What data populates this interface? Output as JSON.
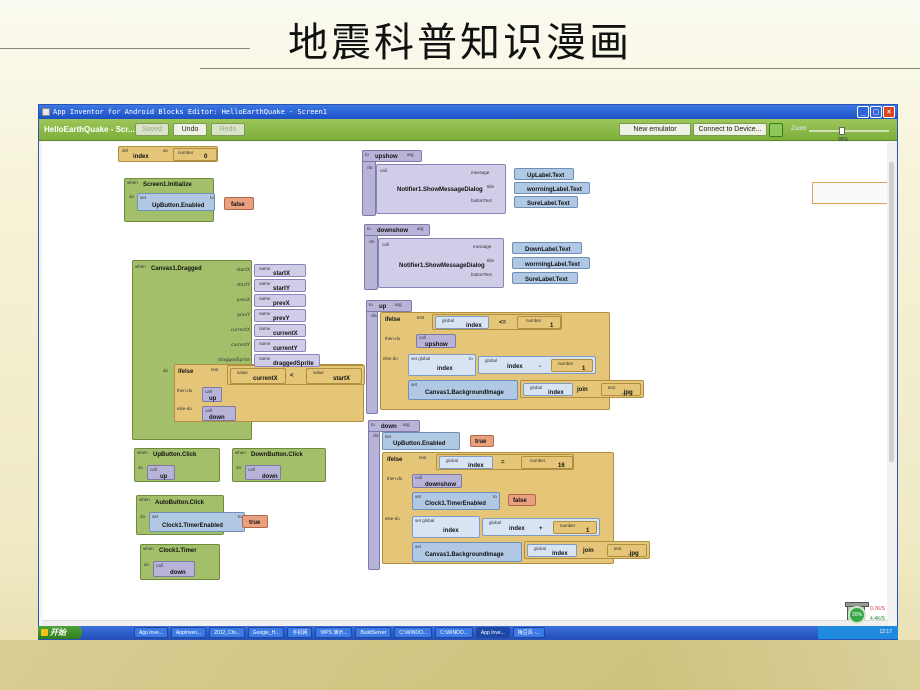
{
  "slide": {
    "title": "地震科普知识漫画"
  },
  "window": {
    "title": "App Inventor for Android Blocks Editor: HelloEarthQuake - Screen1",
    "controls": [
      "_",
      "□",
      "×"
    ]
  },
  "toolbar": {
    "project": "HelloEarthQuake - Scr...",
    "saved": "Saved",
    "undo": "Undo",
    "redo": "Redo",
    "new_emulator": "New emulator",
    "connect": "Connect to Device...",
    "zoom_label": "Zoom",
    "zoom_value": "96%"
  },
  "blocks": {
    "def_index": {
      "def": "def",
      "name": "index",
      "as": "as",
      "type": "number",
      "value": "0"
    },
    "screen_init": {
      "when": "when",
      "event": "Screen1.Initialize",
      "do": "do",
      "set": "set",
      "target": "UpButton.Enabled",
      "to": "to",
      "value": "false"
    },
    "canvas_dragged": {
      "when": "when",
      "event": "Canvas1.Dragged",
      "params": [
        {
          "label": "startX",
          "name": "name",
          "value": "startX"
        },
        {
          "label": "startY",
          "name": "name",
          "value": "startY"
        },
        {
          "label": "prevX",
          "name": "name",
          "value": "prevX"
        },
        {
          "label": "prevY",
          "name": "name",
          "value": "prevY"
        },
        {
          "label": "currentX",
          "name": "name",
          "value": "currentX"
        },
        {
          "label": "currentY",
          "name": "name",
          "value": "currentY"
        },
        {
          "label": "draggedSprite",
          "name": "name",
          "value": "draggedSprite"
        }
      ],
      "do": "do",
      "ifelse": "ifelse",
      "test": "test",
      "value": "value",
      "lhs": "currentX",
      "op": "<",
      "rhs": "startX",
      "then": "then-do",
      "else": "else-do",
      "call": "call",
      "then_call": "up",
      "else_call": "down"
    },
    "upbutton_click": {
      "when": "when",
      "event": "UpButton.Click",
      "do": "do",
      "call": "call",
      "target": "up"
    },
    "downbutton_click": {
      "when": "when",
      "event": "DownButton.Click",
      "do": "do",
      "call": "call",
      "target": "down"
    },
    "autobutton_click": {
      "when": "when",
      "event": "AutoButton.Click",
      "do": "do",
      "set": "set",
      "target": "Clock1.TimerEnabled",
      "to": "to",
      "value": "true"
    },
    "clock_timer": {
      "when": "when",
      "event": "Clock1.Timer",
      "do": "do",
      "call": "call",
      "target": "down"
    },
    "upshow": {
      "to": "to",
      "name": "upshow",
      "arg": "arg",
      "do": "do",
      "call": "call",
      "method": "Notifier1.ShowMessageDialog",
      "message_label": "message",
      "message": "UpLabel.Text",
      "title_label": "title",
      "title": "worrningLabel.Text",
      "button_label": "buttonText",
      "button": "SureLabel.Text"
    },
    "downshow": {
      "to": "to",
      "name": "downshow",
      "arg": "arg",
      "do": "do",
      "call": "call",
      "method": "Notifier1.ShowMessageDialog",
      "message_label": "message",
      "message": "DownLabel.Text",
      "title_label": "title",
      "title": "worrningLabel.Text",
      "button_label": "buttonText",
      "button": "SureLabel.Text"
    },
    "up": {
      "to": "to",
      "name": "up",
      "arg": "arg",
      "do": "do",
      "ifelse": "ifelse",
      "test": "test",
      "global": "global",
      "var": "index",
      "op": "<=",
      "number": "number",
      "num": "1",
      "then": "then-do",
      "call": "call",
      "then_call": "upshow",
      "else": "else-do",
      "set_global": "set global",
      "set_var": "index",
      "minus": "-",
      "num2": "1",
      "set": "set",
      "set_target": "Canvas1.BackgroundImage",
      "join": "join",
      "text": "text",
      "ext": ".jpg"
    },
    "down": {
      "to": "to",
      "name": "down",
      "arg": "arg",
      "do": "do",
      "set": "set",
      "set_target": "UpButton.Enabled",
      "set_value": "true",
      "ifelse": "ifelse",
      "test": "test",
      "global": "global",
      "var": "index",
      "op": "=",
      "number": "number",
      "num": "16",
      "then": "then-do",
      "call": "call",
      "then_call": "downshow",
      "then_set": "Clock1.TimerEnabled",
      "then_value": "false",
      "else": "else-do",
      "set_global": "set global",
      "set_var": "index",
      "plus": "+",
      "num2": "1",
      "img_target": "Canvas1.BackgroundImage",
      "join": "join",
      "text": "text",
      "ext": ".jpg"
    }
  },
  "taskbar": {
    "start": "开始",
    "tasks": [
      "App Inve...",
      "AppInven...",
      "2012_Chi...",
      "Google_H...",
      "手机网",
      "WPS 演示...",
      "BuildServer",
      "C:\\WINDO...",
      "C:\\WINDO...",
      "App Inve...",
      "梅豆风 -..."
    ],
    "clock": "12:17"
  },
  "overlay": {
    "percent": "20%",
    "up": "0.7K/S",
    "down": "4.4K/S"
  }
}
